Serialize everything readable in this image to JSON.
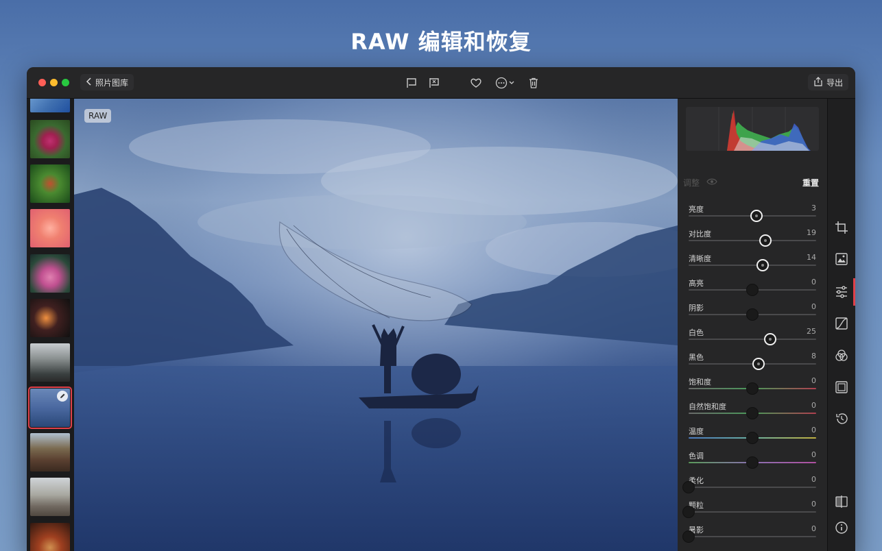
{
  "hero": {
    "title": "RAW 编辑和恢复"
  },
  "toolbar": {
    "back_label": "照片图库",
    "export_label": "导出"
  },
  "photo": {
    "badge": "RAW"
  },
  "panel": {
    "adjust_title": "调整",
    "reset_label": "重置",
    "sliders": [
      {
        "label": "亮度",
        "value": "3",
        "level": 0.53,
        "active": true,
        "track": "#4a4a4c"
      },
      {
        "label": "对比度",
        "value": "19",
        "level": 0.6,
        "active": true,
        "track": "#4a4a4c"
      },
      {
        "label": "清晰度",
        "value": "14",
        "level": 0.58,
        "active": true,
        "track": "#4a4a4c"
      },
      {
        "label": "高亮",
        "value": "0",
        "level": 0.5,
        "active": false,
        "track": "#4a4a4c"
      },
      {
        "label": "阴影",
        "value": "0",
        "level": 0.5,
        "active": false,
        "track": "#4a4a4c"
      },
      {
        "label": "白色",
        "value": "25",
        "level": 0.64,
        "active": true,
        "track": "#4a4a4c"
      },
      {
        "label": "黑色",
        "value": "8",
        "level": 0.55,
        "active": true,
        "track": "#4a4a4c"
      },
      {
        "label": "饱和度",
        "value": "0",
        "level": 0.5,
        "active": false,
        "track": "linear-gradient(90deg,#6a6a6a,#4a9a5a,#b04050)"
      },
      {
        "label": "自然饱和度",
        "value": "0",
        "level": 0.5,
        "active": false,
        "track": "linear-gradient(90deg,#6a6a6a,#4a9a5a,#b04050)"
      },
      {
        "label": "温度",
        "value": "0",
        "level": 0.5,
        "active": false,
        "track": "linear-gradient(90deg,#4a7ac0,#6ab0a0,#c0b040)"
      },
      {
        "label": "色调",
        "value": "0",
        "level": 0.5,
        "active": false,
        "track": "linear-gradient(90deg,#5a9a5a,#8a70b0,#b050a0)"
      },
      {
        "label": "柔化",
        "value": "0",
        "level": 0.0,
        "active": false,
        "track": "#4a4a4c"
      },
      {
        "label": "颗粒",
        "value": "0",
        "level": 0.0,
        "active": false,
        "track": "#4a4a4c"
      },
      {
        "label": "暑影",
        "value": "0",
        "level": 0.0,
        "active": false,
        "track": "#4a4a4c"
      }
    ]
  },
  "colors": {
    "accent": "#e0404a",
    "window_bg": "#1e1e1f",
    "panel_bg": "#262627"
  },
  "icons": {
    "toolbar": [
      "flag-icon",
      "reject-flag-icon",
      "heart-icon",
      "more-icon",
      "trash-icon",
      "share-icon"
    ],
    "rail": [
      "crop-icon",
      "image-icon",
      "adjust-sliders-icon",
      "curves-icon",
      "color-mixer-icon",
      "frame-icon",
      "history-icon",
      "compare-icon",
      "info-icon"
    ]
  }
}
